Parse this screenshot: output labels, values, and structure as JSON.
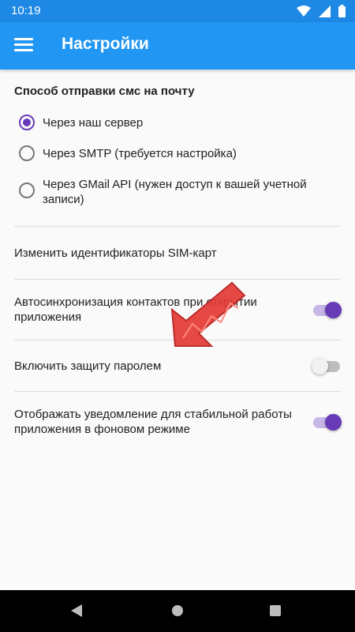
{
  "status_bar": {
    "time": "10:19",
    "icons": [
      "wifi-icon",
      "cellular-signal-icon",
      "battery-icon"
    ]
  },
  "app_bar": {
    "title": "Настройки",
    "menu_icon": "hamburger-menu-icon",
    "background": "#2196f3"
  },
  "sms_section": {
    "title": "Способ отправки смс на почту",
    "options": [
      {
        "label": "Через наш сервер",
        "selected": true
      },
      {
        "label": "Через SMTP (требуется настройка)",
        "selected": false
      },
      {
        "label": "Через GMail API (нужен доступ к вашей учетной записи)",
        "selected": false
      }
    ]
  },
  "preferences": [
    {
      "label": "Изменить идентификаторы SIM-карт"
    },
    {
      "label": "Автосинхронизация контактов при открытии приложения",
      "switch_on": true
    },
    {
      "label": "Включить защиту паролем",
      "switch_on": false
    },
    {
      "label": "Отображать уведомление для стабильной работы приложения в фоновом режиме",
      "switch_on": true
    }
  ],
  "colors": {
    "accent": "#673ab7",
    "primary": "#2196f3",
    "annotation_arrow": "#e53935"
  },
  "nav_bar": {
    "buttons": [
      "back-icon",
      "home-icon",
      "recent-apps-icon"
    ]
  }
}
